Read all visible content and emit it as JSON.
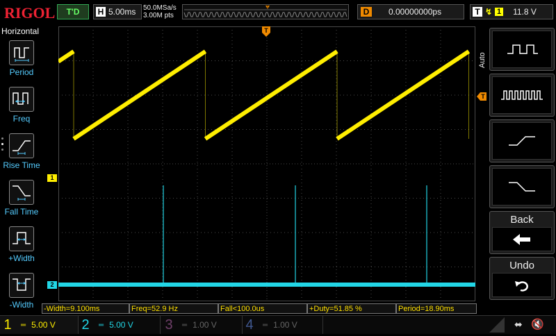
{
  "topbar": {
    "logo": "RIGOL",
    "run_status": "T'D",
    "horizontal_key": "H",
    "timebase": "5.00ms",
    "sample_rate": "50.0MSa/s",
    "memory_depth": "3.00M pts",
    "delay_key": "D",
    "delay_value": "0.00000000ps",
    "trigger_key": "T",
    "trigger_source": "1",
    "trigger_level": "11.8 V"
  },
  "left_menu": {
    "title": "Horizontal",
    "items": [
      {
        "label": "Period",
        "icon": "period-icon"
      },
      {
        "label": "Freq",
        "icon": "frequency-icon"
      },
      {
        "label": "Rise Time",
        "icon": "rise-time-icon"
      },
      {
        "label": "Fall Time",
        "icon": "fall-time-icon"
      },
      {
        "label": "+Width",
        "icon": "positive-width-icon"
      },
      {
        "label": "-Width",
        "icon": "negative-width-icon"
      }
    ]
  },
  "right_menu": {
    "tab_label": "Auto",
    "buttons": [
      {
        "name": "pulse-wide-button",
        "icon": "wide-pulse-icon"
      },
      {
        "name": "pulse-train-button",
        "icon": "pulse-train-icon"
      },
      {
        "name": "rising-edge-button",
        "icon": "rising-edge-icon"
      },
      {
        "name": "falling-edge-button",
        "icon": "falling-edge-icon"
      },
      {
        "name": "back-button",
        "label": "Back",
        "icon": "back-arrow-icon"
      },
      {
        "name": "undo-button",
        "label": "Undo",
        "icon": "undo-icon"
      }
    ]
  },
  "plot": {
    "trigger_position_marker": "T",
    "ch1_marker": "1",
    "ch2_marker": "2",
    "colors": {
      "ch1": "#ffee00",
      "ch2": "#22d6e6",
      "trigger": "#f08a00",
      "grid": "#4a4a4a"
    }
  },
  "measurements": [
    "-Width=9.100ms",
    "Freq=52.9 Hz",
    "Fall<100.0us",
    "+Duty=51.85 %",
    "Period=18.90ms"
  ],
  "channels": [
    {
      "number": "1",
      "scale": "5.00 V",
      "color": "#ffee00",
      "active": true
    },
    {
      "number": "2",
      "scale": "5.00 V",
      "color": "#22d6e6",
      "active": true
    },
    {
      "number": "3",
      "scale": "1.00 V",
      "color": "#a05090",
      "active": false
    },
    {
      "number": "4",
      "scale": "1.00 V",
      "color": "#5070c0",
      "active": false
    }
  ],
  "status_icons": [
    "usb-icon",
    "sound-muted-icon"
  ]
}
